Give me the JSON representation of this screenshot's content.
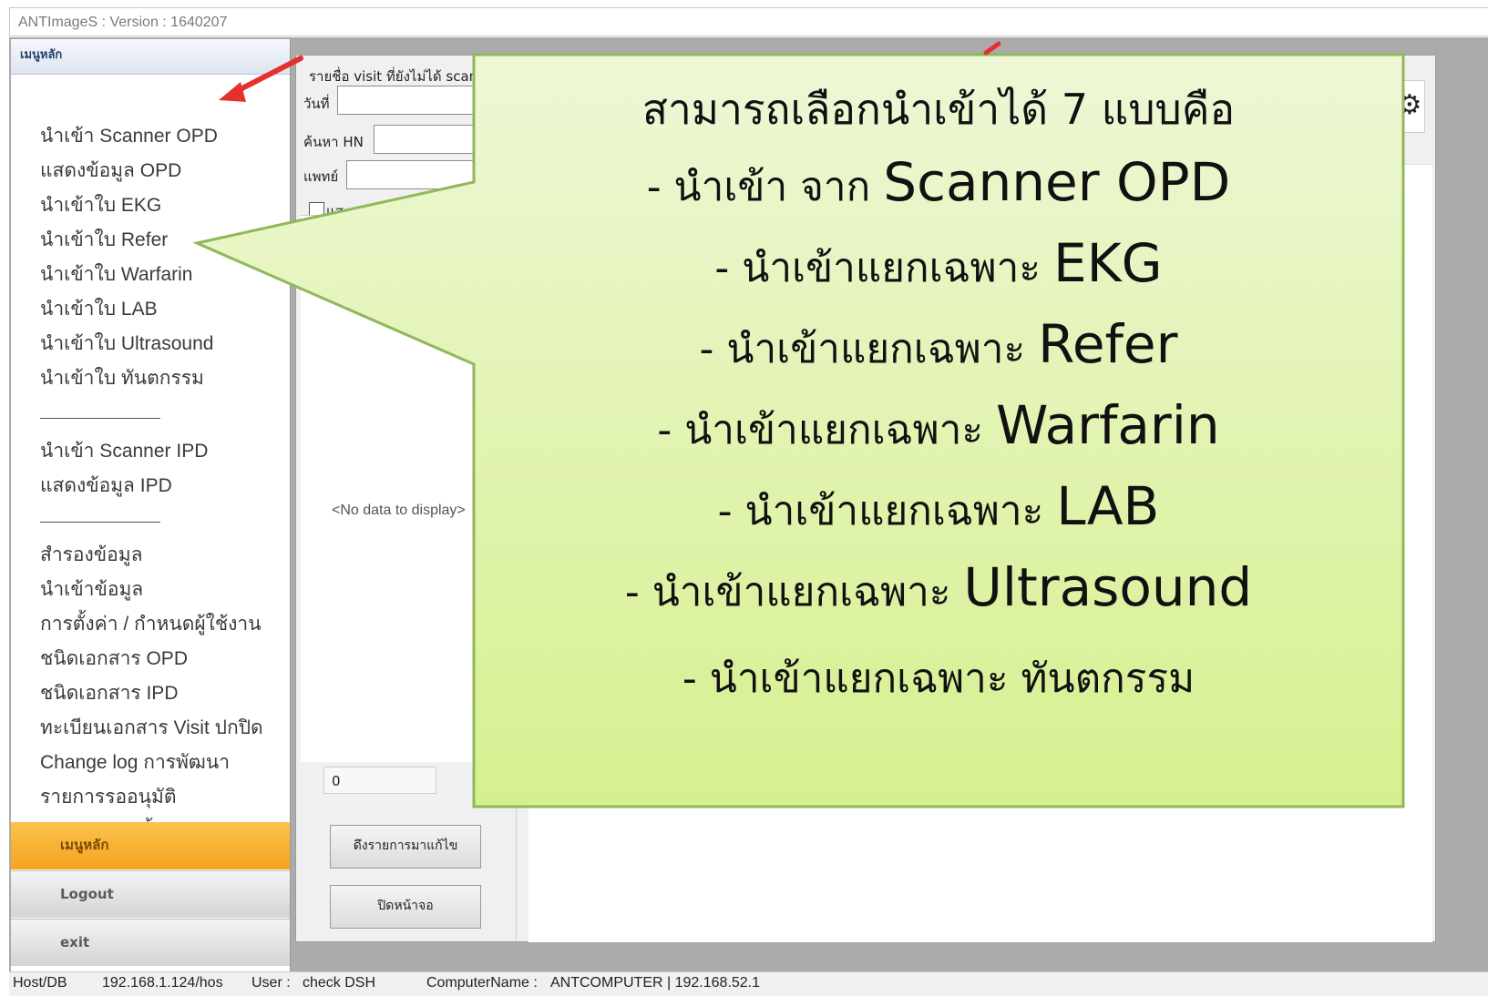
{
  "window": {
    "title": "ANTImageS : Version : 1640207"
  },
  "sidebar": {
    "header": "เมนูหลัก",
    "items": [
      "นำเข้า Scanner OPD",
      "แสดงข้อมูล OPD",
      "นำเข้าใบ EKG",
      "นำเข้าใบ Refer",
      "นำเข้าใบ Warfarin",
      "นำเข้าใบ LAB",
      "นำเข้าใบ Ultrasound",
      "นำเข้าใบ ทันตกรรม",
      "นำเข้า Scanner IPD",
      "แสดงข้อมูล IPD",
      "สำรองข้อมูล",
      "นำเข้าข้อมูล",
      "การตั้งค่า / กำหนดผู้ใช้งาน",
      "ชนิดเอกสาร OPD",
      "ชนิดเอกสาร IPD",
      "ทะเบียนเอกสาร Visit ปกปิด",
      "Change log การพัฒนา",
      "รายการรออนุมัติ",
      "รายการขอปริ้น"
    ],
    "nav": {
      "main": "เมนูหลัก",
      "logout": "Logout",
      "exit": "exit"
    }
  },
  "panel": {
    "title": "รายชื่อ visit ที่ยังไม่ได้ scan",
    "date_label": "วันที่",
    "hn_label": "ค้นหา HN",
    "doctor_label": "แพทย์",
    "checkbox_label": "แส",
    "no_data": "<No data to display>",
    "count": "0",
    "fetch_button": "ดึงรายการมาแก้ไข",
    "close_button": "ปิดหน้าจอ"
  },
  "callout": {
    "heading": "สามารถเลือกนำเข้าได้ 7 แบบคือ",
    "lines": [
      {
        "th": "- นำเข้า จาก ",
        "en": "Scanner OPD"
      },
      {
        "th": "- นำเข้าแยกเฉพาะ ",
        "en": "EKG"
      },
      {
        "th": "- นำเข้าแยกเฉพาะ ",
        "en": "Refer"
      },
      {
        "th": "- นำเข้าแยกเฉพาะ ",
        "en": "Warfarin"
      },
      {
        "th": "- นำเข้าแยกเฉพาะ ",
        "en": "LAB"
      },
      {
        "th": "- นำเข้าแยกเฉพาะ ",
        "en": "Ultrasound"
      },
      {
        "th": "- นำเข้าแยกเฉพาะ  ทันตกรรม",
        "en": ""
      }
    ],
    "fill_top": "#eef7d6",
    "fill_bottom": "#d6f08f",
    "border": "#8fb85a"
  },
  "statusbar": {
    "host_label": "Host/DB",
    "host_value": "192.168.1.124/hos",
    "user_label": "User :",
    "user_value": "check DSH",
    "computer_label": "ComputerName :",
    "computer_value": "ANTCOMPUTER | 192.168.52.1"
  },
  "colors": {
    "arrow": "#e53030",
    "nav_active": "#f6a31d"
  }
}
